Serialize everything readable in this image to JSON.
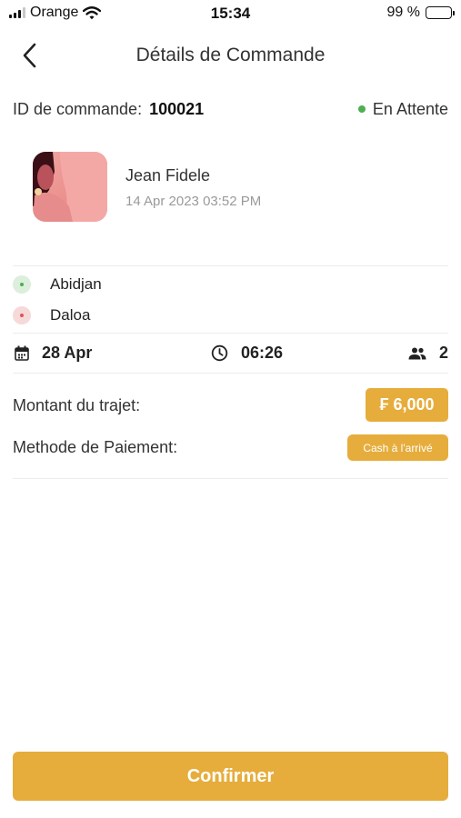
{
  "status_bar": {
    "carrier": "Orange",
    "time": "15:34",
    "battery": "99 %",
    "battery_level": 0.99
  },
  "header": {
    "back_icon": "chevron-left-icon",
    "title": "Détails de Commande"
  },
  "order": {
    "id_label": "ID de commande:",
    "id": "100021",
    "status": "En Attente",
    "status_color": "#4caf50"
  },
  "customer": {
    "name": "Jean Fidele",
    "date": "14 Apr 2023  03:52 PM"
  },
  "route": {
    "origin": "Abidjan",
    "destination": "Daloa"
  },
  "trip": {
    "date": "28 Apr",
    "time": "06:26",
    "passengers": "2"
  },
  "payment": {
    "amount_label": "Montant du trajet:",
    "amount": "₣ 6,000",
    "method_label": "Methode de Paiement:",
    "method": "Cash à l'arrivé"
  },
  "actions": {
    "confirm": "Confirmer"
  },
  "colors": {
    "accent": "#e6ad3c",
    "origin": "#4caf50",
    "destination": "#e05555"
  }
}
